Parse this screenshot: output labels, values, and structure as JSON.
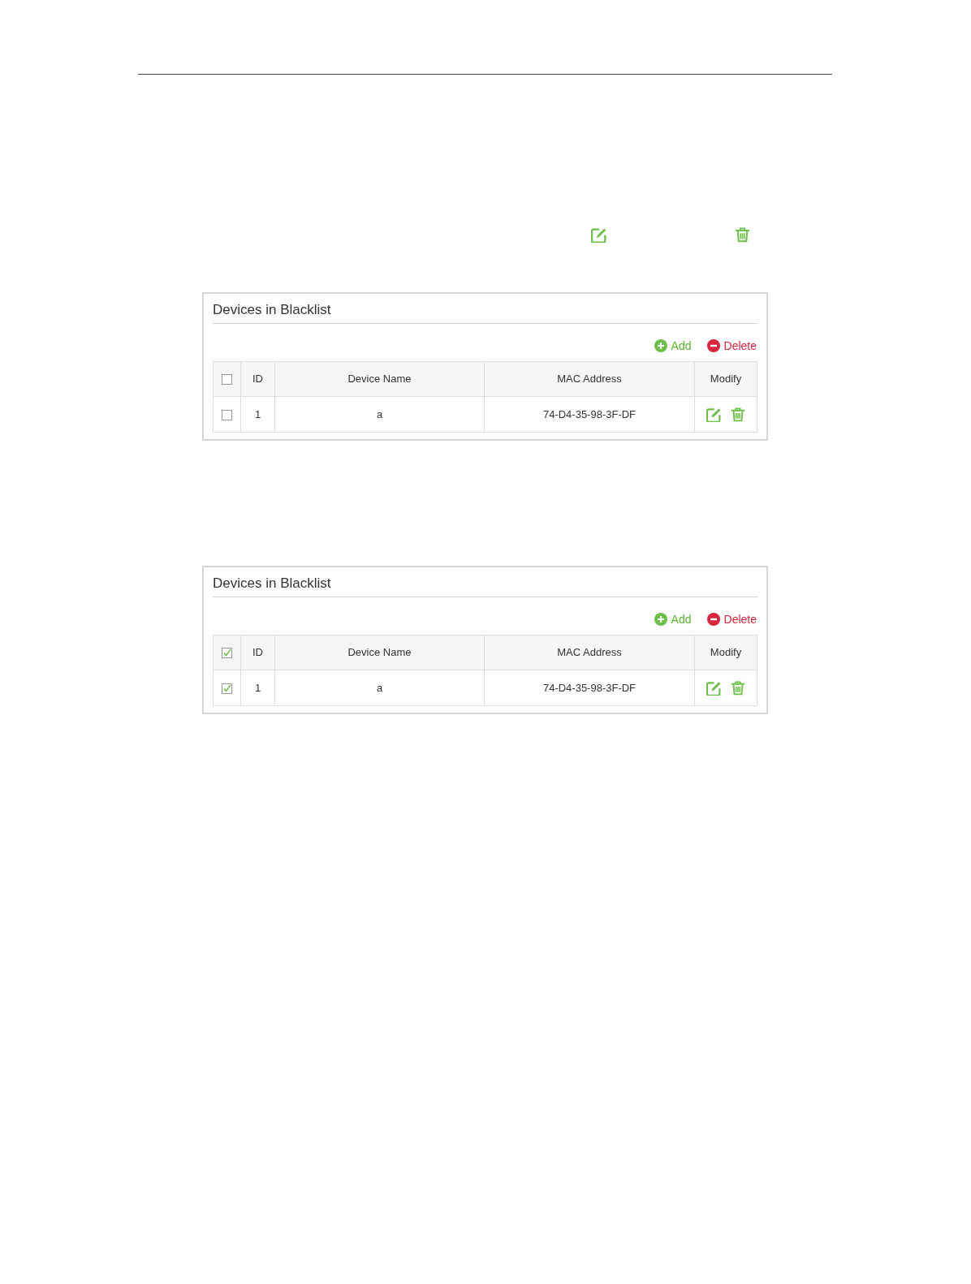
{
  "panels": [
    {
      "title": "Devices in Blacklist",
      "actions": [
        {
          "kind": "add",
          "label": "Add"
        },
        {
          "kind": "delete",
          "label": "Delete"
        }
      ],
      "table": {
        "select_all": {
          "checked": false
        },
        "columns": [
          "ID",
          "Device Name",
          "MAC Address",
          "Modify"
        ],
        "rows": [
          {
            "checked": false,
            "id": "1",
            "device_name": "a",
            "mac_address": "74-D4-35-98-3F-DF"
          }
        ]
      }
    },
    {
      "title": "Devices in Blacklist",
      "actions": [
        {
          "kind": "add",
          "label": "Add"
        },
        {
          "kind": "delete",
          "label": "Delete"
        }
      ],
      "table": {
        "select_all": {
          "checked": true
        },
        "columns": [
          "ID",
          "Device Name",
          "MAC Address",
          "Modify"
        ],
        "rows": [
          {
            "checked": true,
            "id": "1",
            "device_name": "a",
            "mac_address": "74-D4-35-98-3F-DF"
          }
        ]
      }
    }
  ]
}
